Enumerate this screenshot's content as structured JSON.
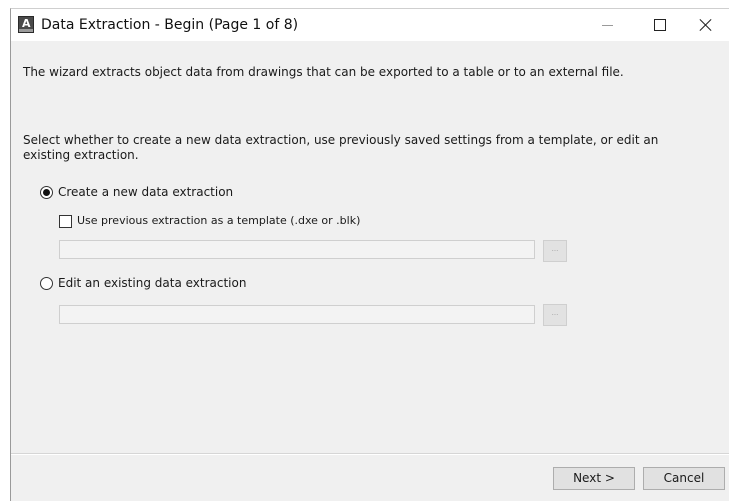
{
  "window": {
    "title": "Data Extraction - Begin (Page 1 of 8)",
    "icon": "autocad-app-icon",
    "icon_letter": "A"
  },
  "window_controls": {
    "minimize_icon": "minimize-icon",
    "maximize_icon": "maximize-icon",
    "close_icon": "close-icon"
  },
  "content": {
    "intro_text": "The wizard extracts object data from drawings that can be exported to a table or to an external file.",
    "select_text": "Select whether to create a new data extraction, use previously saved settings from a template, or edit an existing extraction."
  },
  "options": {
    "create_new": {
      "label": "Create a new data extraction",
      "selected": true
    },
    "use_template": {
      "label": "Use previous extraction as a template (.dxe or .blk)",
      "checked": false,
      "path_value": "",
      "browse_label": "..."
    },
    "edit_existing": {
      "label": "Edit an existing data extraction",
      "selected": false,
      "path_value": "",
      "browse_label": "..."
    }
  },
  "footer": {
    "next_label": "Next >",
    "cancel_label": "Cancel"
  }
}
